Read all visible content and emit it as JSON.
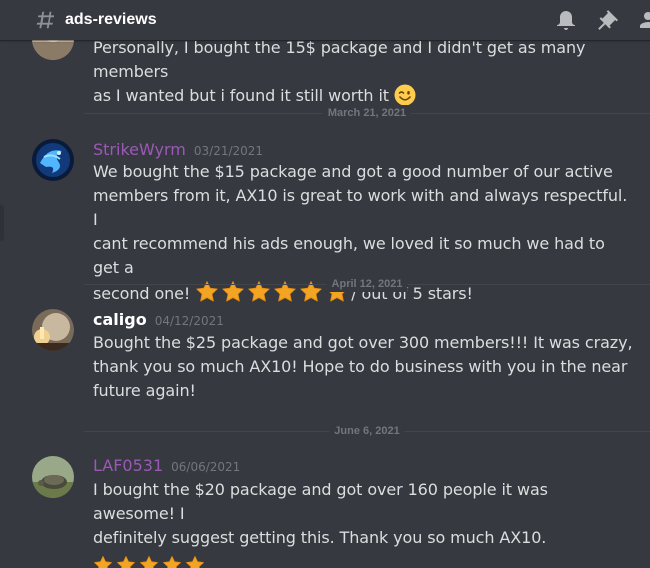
{
  "channel": {
    "name": "ads-reviews"
  },
  "colors": {
    "background": "#36393f",
    "text": "#dcddde",
    "muted": "#72767d",
    "role_purple": "#9b59b6",
    "white": "#ffffff",
    "star": "#f4a423"
  },
  "messages": [
    {
      "continuation": true,
      "lines": [
        "Personally, I bought the 15$ package and I didn't get as many members",
        "as I wanted but i found it still worth it"
      ],
      "emoji": "winking-face"
    },
    {
      "divider": "March 21, 2021",
      "username": "StrikeWyrm",
      "timestamp": "03/21/2021",
      "lines": [
        "We bought the $15 package and got a good number of our active",
        "members from it, AX10 is great to work with and always respectful. I",
        "cant recommend his ads enough, we loved it so much we had to get a",
        "second one!"
      ],
      "stars_count": 6,
      "after_stars": "/ out of 5 stars!"
    },
    {
      "divider": "April 12, 2021",
      "username": "caligo",
      "timestamp": "04/12/2021",
      "lines": [
        "Bought the $25 package and got over 300 members!!! It was crazy,",
        "thank you so much AX10! Hope to do business with you in the near",
        "future again!"
      ]
    },
    {
      "divider": "June 6, 2021",
      "username": "LAF0531",
      "timestamp": "06/06/2021",
      "lines": [
        "I bought the $20 package and got over 160 people it was awesome! I",
        "definitely suggest getting this. Thank you so much AX10."
      ],
      "stars_count": 5
    }
  ]
}
